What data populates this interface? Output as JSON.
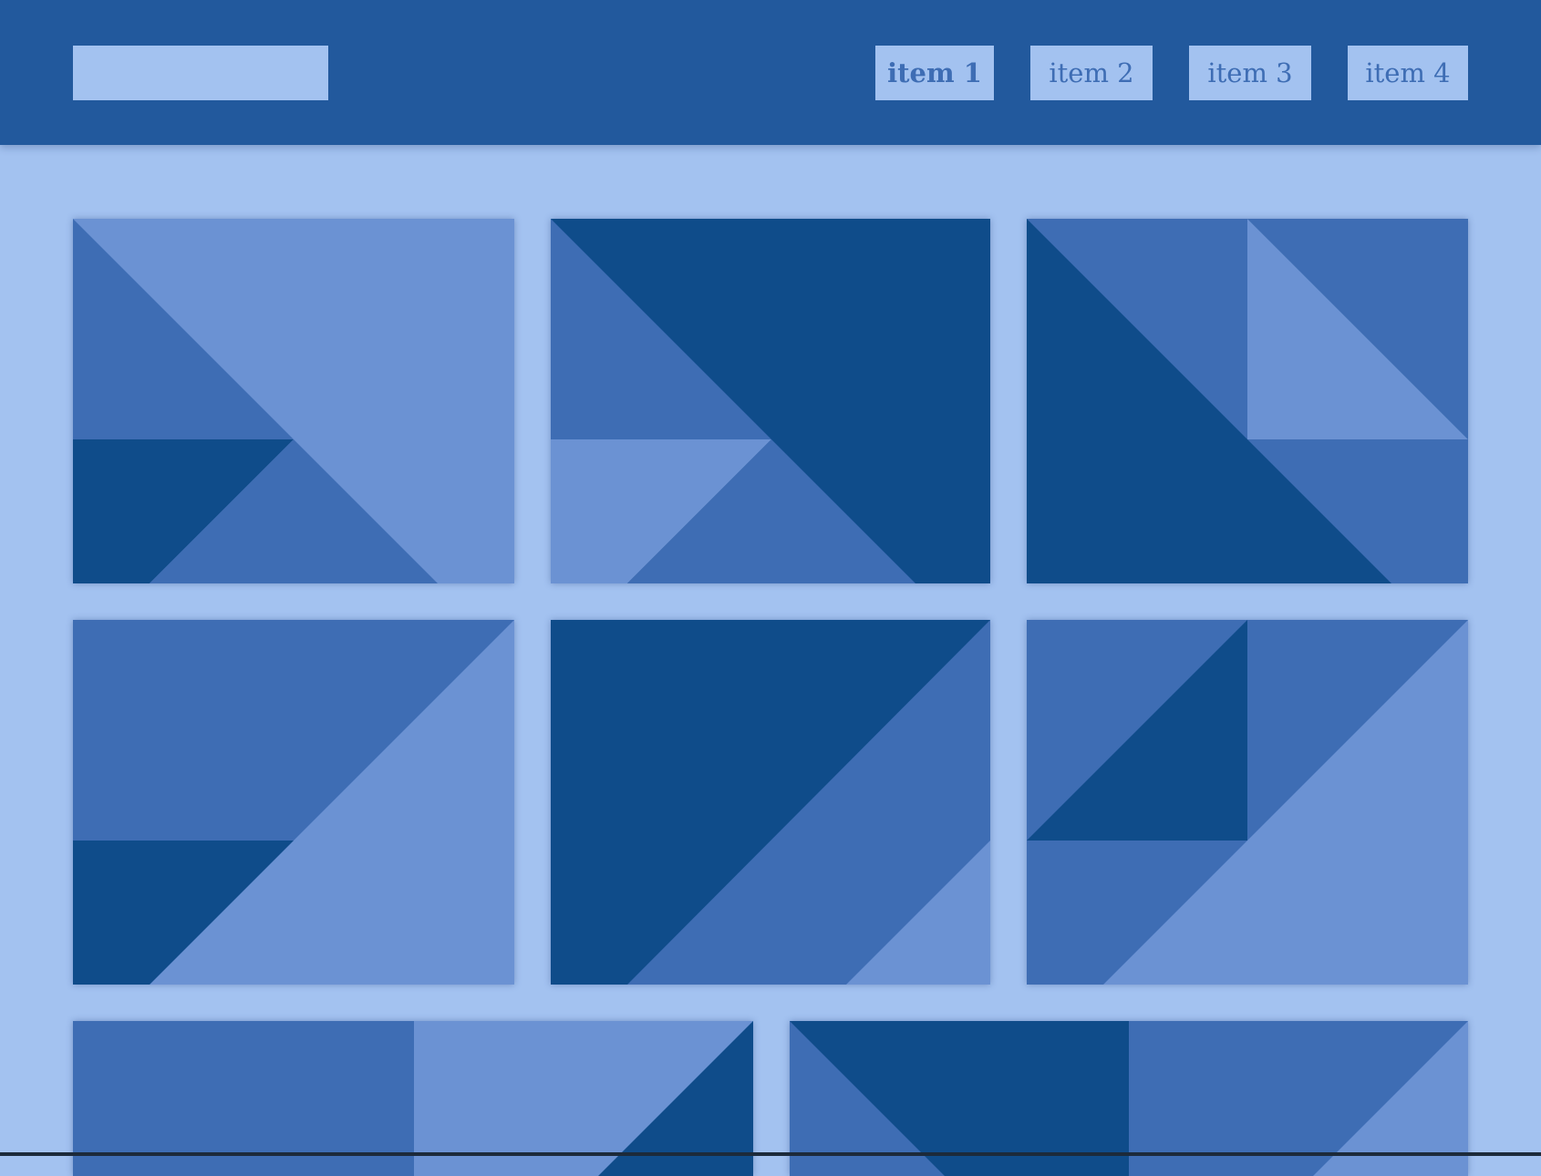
{
  "header": {
    "nav": [
      {
        "label": "item 1",
        "active": true
      },
      {
        "label": "item 2",
        "active": false
      },
      {
        "label": "item 3",
        "active": false
      },
      {
        "label": "item 4",
        "active": false
      }
    ]
  },
  "palette": {
    "header_bg": "#22599d",
    "page_bg": "#a3c2f0",
    "tile_dark": "#0f4c8a",
    "tile_mid": "#3e6db4",
    "tile_light": "#6b92d3"
  }
}
